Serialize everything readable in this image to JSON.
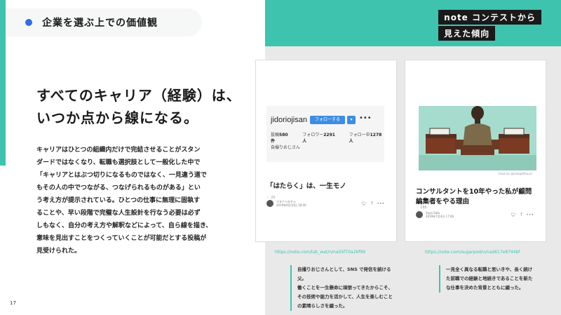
{
  "header": {
    "title": "企業を選ぶ上での価値観"
  },
  "corner_tag": {
    "line1": "note コンテストから",
    "line2": "見えた傾向"
  },
  "headline": {
    "line1": "すべてのキャリア（経験）は、",
    "line2": "いつか点から線になる。"
  },
  "body": {
    "lines": [
      "キャリアはひとつの組織内だけで完結させることがスタン",
      "ダードではなくなり、転職も選択肢として一般化した中で",
      "「キャリアとはぶつ切りになるものではなく、一見違う道で",
      "もその人の中でつながる、つなげられるものがある」とい",
      "う考え方が提示されている。ひとつの仕事に無理に固執す",
      "ることや、早い段階で完璧な人生設計を行なう必要は必ず",
      "しもなく、自分の考え方や解釈などによって、自ら線を描き、",
      "意味を見出すことをつくっていくことが可能だとする投稿が",
      "見受けられた。"
    ]
  },
  "page_number": "17",
  "card_a": {
    "profile_name": "jidoriojisan",
    "follow_label": "フォローする",
    "follow_drop": "▾",
    "more": "•••",
    "stats": [
      {
        "label": "投稿",
        "value": "580件"
      },
      {
        "label": "フォロワー",
        "value": "2291人"
      },
      {
        "label": "フォロー中",
        "value": "1278人"
      }
    ],
    "profile_sub": "自撮りおじさん",
    "title": "「はたらく」は、一生モノ",
    "author": "ワタナベタケシ",
    "date": "2019年9月10日 18:00",
    "likes": "♡ 25",
    "link": "https://note.com/tak_wat/n/na05f70a2bf99",
    "description": [
      "自撮りおじさんとして、SNS で発信を続ける父。",
      "働くことを一生懸命に頑張ってきたからこそ、",
      "その技術や能力を活かして、人生を楽しむこと",
      "の素晴らしさを綴った。"
    ]
  },
  "card_b": {
    "illustration_credit": "Illust by @saingothouse",
    "title": "コンサルタントを10年やった私が顧問編集者をやる理由",
    "author": "Saya Sato",
    "date": "2019年7月4日 17:00",
    "likes": "♡ 188",
    "link": "https://note.com/sugarpod/n/nad617e8744bf",
    "description": [
      "一見全く異なる転職と思いきや、長く続け",
      "た前職での経験と地続きであることを新た",
      "な仕事を決めた背景とともに綴った。"
    ]
  },
  "colors": {
    "teal": "#3ec3ae",
    "accent_blue": "#2f6fe6",
    "follow_blue": "#3c8ee2"
  }
}
